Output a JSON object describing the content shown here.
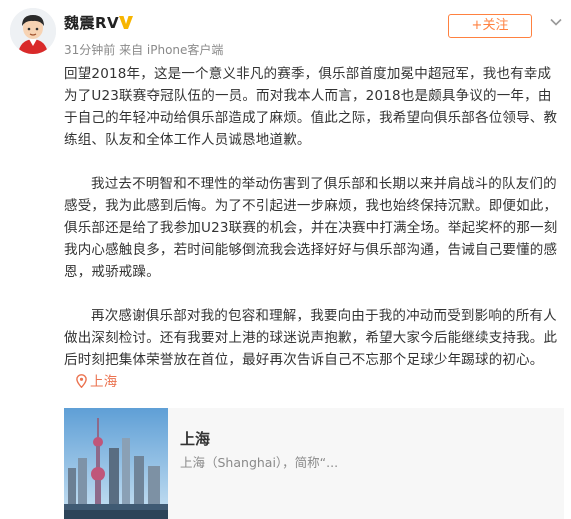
{
  "post": {
    "username": "魏震RV",
    "meta": "31分钟前 来自 iPhone客户端",
    "follow_label": "+关注",
    "paragraphs": [
      "回望2018年，这是一个意义非凡的赛季，俱乐部首度加冕中超冠军，我也有幸成为了U23联赛夺冠队伍的一员。而对我本人而言，2018也是颇具争议的一年，由于自己的年轻冲动给俱乐部造成了麻烦。值此之际，我希望向俱乐部各位领导、教练组、队友和全体工作人员诚恳地道歉。",
      "我过去不明智和不理性的举动伤害到了俱乐部和长期以来并肩战斗的队友们的感受，我为此感到后悔。为了不引起进一步麻烦，我也始终保持沉默。即便如此，俱乐部还是给了我参加U23联赛的机会，并在决赛中打满全场。举起奖杯的那一刻我内心感触良多，若时间能够倒流我会选择好好与俱乐部沟通，告诫自己要懂的感恩，戒骄戒躁。",
      "再次感谢俱乐部对我的包容和理解，我要向由于我的冲动而受到影响的所有人做出深刻检讨。还有我要对上港的球迷说声抱歉，希望大家今后能继续支持我。此后时刻把集体荣誉放在首位，最好再次告诉自己不忘那个足球少年踢球的初心。"
    ],
    "location_tag": "上海"
  },
  "location_card": {
    "title": "上海",
    "subtitle": "上海（Shanghai），简称“..."
  },
  "icons": {
    "verified": "verified-v-icon",
    "menu": "chevron-down-icon",
    "location": "location-pin-icon"
  },
  "colors": {
    "accent": "#ff8140",
    "verified": "#f7b500",
    "location": "#eb7350"
  }
}
